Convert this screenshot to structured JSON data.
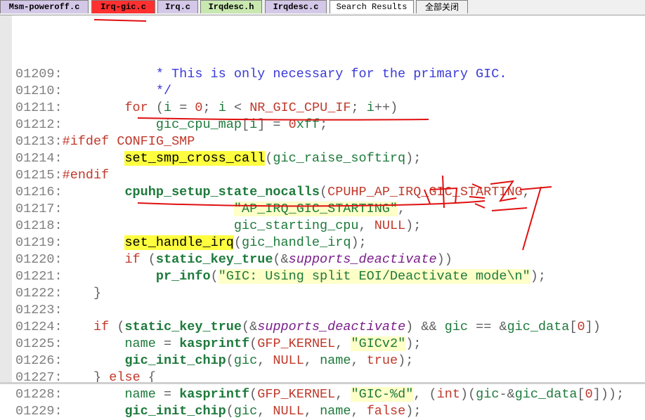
{
  "tabs": [
    {
      "label": "Msm-poweroff.c",
      "bg": "#d4c8e8"
    },
    {
      "label": "Irq-gic.c",
      "bg": "#ff3030"
    },
    {
      "label": "Irq.c",
      "bg": "#d4c8e8"
    },
    {
      "label": "Irqdesc.h",
      "bg": "#c8e8b0"
    },
    {
      "label": "Irqdesc.c",
      "bg": "#d4c8e8"
    },
    {
      "label": "Search Results",
      "bg": "#ffffff"
    },
    {
      "label": "全部关闭",
      "bg": "#f0f0f0"
    }
  ],
  "lines": [
    {
      "n": "01209:",
      "t": "            * This is only necessary for the primary GIC."
    },
    {
      "n": "01210:",
      "t": "            */"
    },
    {
      "n": "01211:",
      "t": "        for (i = 0; i < NR_GIC_CPU_IF; i++)"
    },
    {
      "n": "01212:",
      "t": "            gic_cpu_map[i] = 0xff;"
    },
    {
      "n": "01213:",
      "t": "#ifdef CONFIG_SMP"
    },
    {
      "n": "01214:",
      "t": "        set_smp_cross_call(gic_raise_softirq);"
    },
    {
      "n": "01215:",
      "t": "#endif"
    },
    {
      "n": "01216:",
      "t": "        cpuhp_setup_state_nocalls(CPUHP_AP_IRQ_GIC_STARTING,"
    },
    {
      "n": "01217:",
      "t": "                      \"AP_IRQ_GIC_STARTING\","
    },
    {
      "n": "01218:",
      "t": "                      gic_starting_cpu, NULL);"
    },
    {
      "n": "01219:",
      "t": "        set_handle_irq(gic_handle_irq);"
    },
    {
      "n": "01220:",
      "t": "        if (static_key_true(&supports_deactivate))"
    },
    {
      "n": "01221:",
      "t": "            pr_info(\"GIC: Using split EOI/Deactivate mode\\n\");"
    },
    {
      "n": "01222:",
      "t": "    }"
    },
    {
      "n": "01223:",
      "t": ""
    },
    {
      "n": "01224:",
      "t": "    if (static_key_true(&supports_deactivate) && gic == &gic_data[0])"
    },
    {
      "n": "01225:",
      "t": "        name = kasprintf(GFP_KERNEL, \"GICv2\");"
    },
    {
      "n": "01226:",
      "t": "        gic_init_chip(gic, NULL, name, true);"
    },
    {
      "n": "01227:",
      "t": "    } else {"
    },
    {
      "n": "01228:",
      "t": "        name = kasprintf(GFP_KERNEL, \"GIC-%d\", (int)(gic-&gic_data[0]));"
    },
    {
      "n": "01229:",
      "t": "        gic_init_chip(gic, NULL, name, false);"
    }
  ],
  "colors": {
    "annotation": "#e01010",
    "highlight": "#ffff40"
  }
}
